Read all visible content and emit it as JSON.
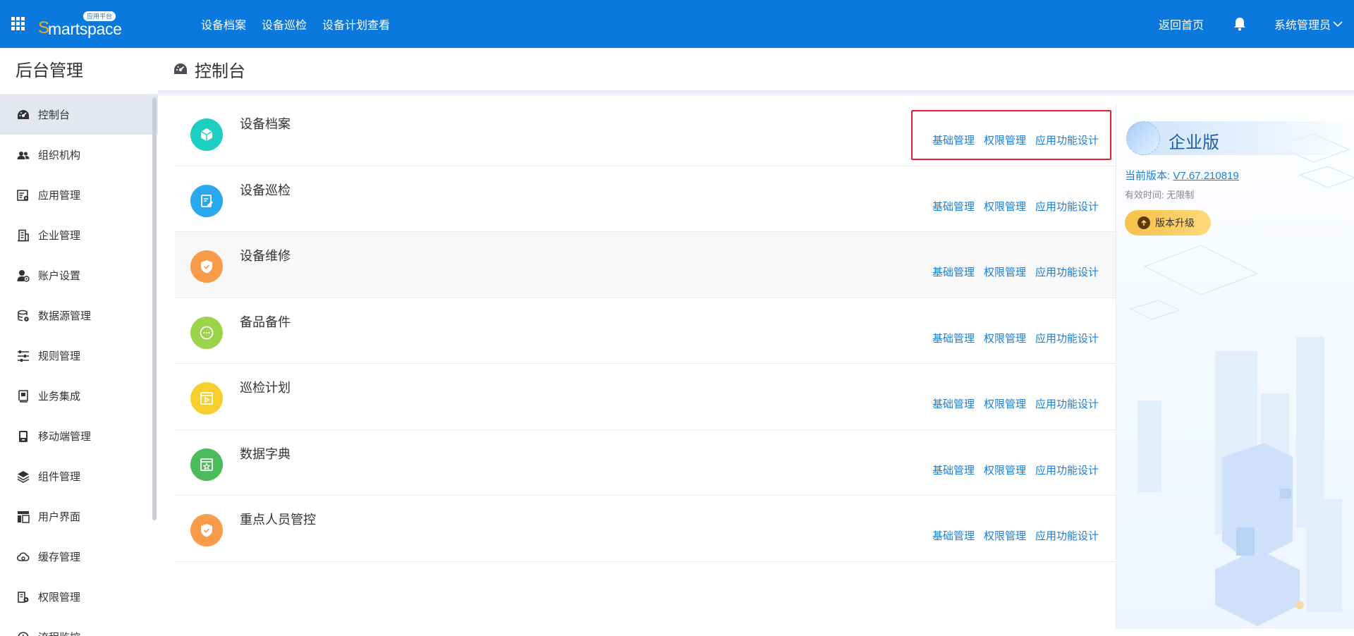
{
  "topbar": {
    "brand_s": "S",
    "brand_rest": "martspace",
    "brand_badge": "应用平台",
    "nav": [
      "设备档案",
      "设备巡检",
      "设备计划查看"
    ],
    "home": "返回首页",
    "user": "系统管理员"
  },
  "sidebar": {
    "title": "后台管理",
    "items": [
      {
        "label": "控制台",
        "icon": "dashboard-icon"
      },
      {
        "label": "组织机构",
        "icon": "users-icon"
      },
      {
        "label": "应用管理",
        "icon": "app-settings-icon"
      },
      {
        "label": "企业管理",
        "icon": "building-icon"
      },
      {
        "label": "账户设置",
        "icon": "user-settings-icon"
      },
      {
        "label": "数据源管理",
        "icon": "database-icon"
      },
      {
        "label": "规则管理",
        "icon": "sliders-icon"
      },
      {
        "label": "业务集成",
        "icon": "book-icon"
      },
      {
        "label": "移动端管理",
        "icon": "mobile-icon"
      },
      {
        "label": "组件管理",
        "icon": "layers-icon"
      },
      {
        "label": "用户界面",
        "icon": "layout-icon"
      },
      {
        "label": "缓存管理",
        "icon": "cloud-icon"
      },
      {
        "label": "权限管理",
        "icon": "permission-icon"
      },
      {
        "label": "流程监控",
        "icon": "flow-icon"
      }
    ]
  },
  "page": {
    "title": "控制台"
  },
  "links": {
    "basic": "基础管理",
    "perm": "权限管理",
    "design": "应用功能设计"
  },
  "apps": [
    {
      "name": "设备档案",
      "color": "#1ccfc0",
      "icon": "cube-icon"
    },
    {
      "name": "设备巡检",
      "color": "#2aa8ee",
      "icon": "edit-doc-icon"
    },
    {
      "name": "设备维修",
      "color": "#f89b4a",
      "icon": "shield-check-icon"
    },
    {
      "name": "备品备件",
      "color": "#9bd44a",
      "icon": "more-circle-icon"
    },
    {
      "name": "巡检计划",
      "color": "#f7cf2d",
      "icon": "play-window-icon"
    },
    {
      "name": "数据字典",
      "color": "#4cbb5c",
      "icon": "star-window-icon"
    },
    {
      "name": "重点人员管控",
      "color": "#f89b4a",
      "icon": "shield-check-icon"
    }
  ],
  "edition": {
    "name": "企业版",
    "version_label": "当前版本: ",
    "version": "V7.67.210819",
    "valid": "有效时间: 无限制",
    "upgrade": "版本升级"
  }
}
